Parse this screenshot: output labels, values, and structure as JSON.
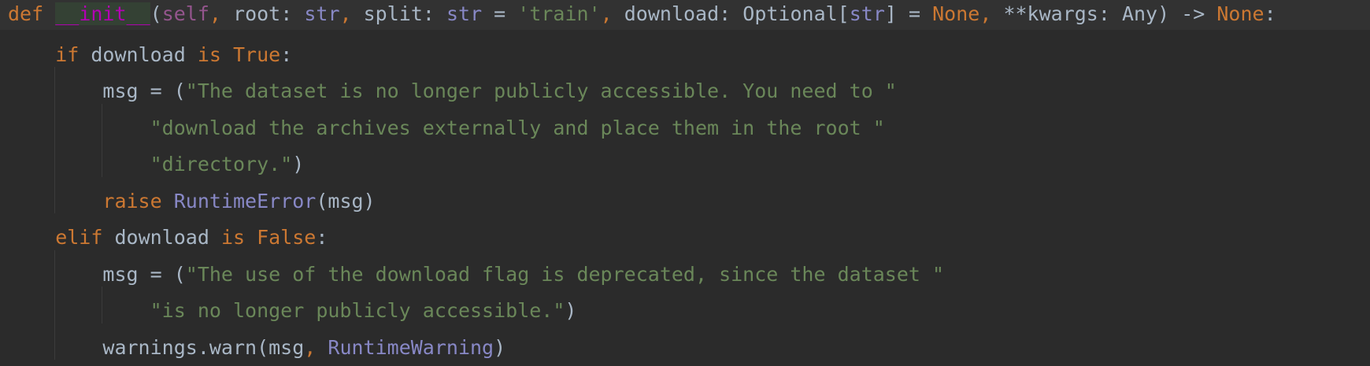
{
  "editor": {
    "language": "python",
    "colors": {
      "background": "#2b2b2b",
      "current_line": "#323232",
      "keyword": "#cc7832",
      "function_name": "#b200b2",
      "self": "#94558d",
      "builtin": "#8888c6",
      "string": "#6a8759",
      "default_text": "#a9b7c6"
    },
    "lines": [
      {
        "indent": 0,
        "tokens": [
          {
            "t": "kw",
            "v": "def "
          },
          {
            "t": "fn",
            "v": "__init__"
          },
          {
            "t": "plain",
            "v": "("
          },
          {
            "t": "selfk",
            "v": "self"
          },
          {
            "t": "kw",
            "v": ", "
          },
          {
            "t": "plain",
            "v": "root: "
          },
          {
            "t": "builtin",
            "v": "str"
          },
          {
            "t": "kw",
            "v": ", "
          },
          {
            "t": "plain",
            "v": "split: "
          },
          {
            "t": "builtin",
            "v": "str"
          },
          {
            "t": "plain",
            "v": " = "
          },
          {
            "t": "str",
            "v": "'train'"
          },
          {
            "t": "kw",
            "v": ", "
          },
          {
            "t": "plain",
            "v": "download: Optional["
          },
          {
            "t": "builtin",
            "v": "str"
          },
          {
            "t": "plain",
            "v": "] = "
          },
          {
            "t": "kw",
            "v": "None"
          },
          {
            "t": "kw",
            "v": ", "
          },
          {
            "t": "plain",
            "v": "**kwargs: Any) -> "
          },
          {
            "t": "kw",
            "v": "None"
          },
          {
            "t": "plain",
            "v": ":"
          }
        ]
      },
      {
        "indent": 1,
        "tokens": [
          {
            "t": "kw",
            "v": "if "
          },
          {
            "t": "plain",
            "v": "download "
          },
          {
            "t": "kw",
            "v": "is "
          },
          {
            "t": "kw",
            "v": "True"
          },
          {
            "t": "plain",
            "v": ":"
          }
        ]
      },
      {
        "indent": 2,
        "tokens": [
          {
            "t": "plain",
            "v": "msg = ("
          },
          {
            "t": "str",
            "v": "\"The dataset is no longer publicly accessible. You need to \""
          }
        ]
      },
      {
        "indent": 3,
        "tokens": [
          {
            "t": "str",
            "v": "\"download the archives externally and place them in the root \""
          }
        ]
      },
      {
        "indent": 3,
        "tokens": [
          {
            "t": "str",
            "v": "\"directory.\""
          },
          {
            "t": "plain",
            "v": ")"
          }
        ]
      },
      {
        "indent": 2,
        "tokens": [
          {
            "t": "kw",
            "v": "raise "
          },
          {
            "t": "cls",
            "v": "RuntimeError"
          },
          {
            "t": "plain",
            "v": "(msg)"
          }
        ]
      },
      {
        "indent": 1,
        "tokens": [
          {
            "t": "kw",
            "v": "elif "
          },
          {
            "t": "plain",
            "v": "download "
          },
          {
            "t": "kw",
            "v": "is "
          },
          {
            "t": "kw",
            "v": "False"
          },
          {
            "t": "plain",
            "v": ":"
          }
        ]
      },
      {
        "indent": 2,
        "tokens": [
          {
            "t": "plain",
            "v": "msg = ("
          },
          {
            "t": "str",
            "v": "\"The use of the download flag is deprecated, since the dataset \""
          }
        ]
      },
      {
        "indent": 3,
        "tokens": [
          {
            "t": "str",
            "v": "\"is no longer publicly accessible.\""
          },
          {
            "t": "plain",
            "v": ")"
          }
        ]
      },
      {
        "indent": 2,
        "tokens": [
          {
            "t": "plain",
            "v": "warnings.warn(msg"
          },
          {
            "t": "kw",
            "v": ", "
          },
          {
            "t": "cls",
            "v": "RuntimeWarning"
          },
          {
            "t": "plain",
            "v": ")"
          }
        ]
      }
    ]
  }
}
